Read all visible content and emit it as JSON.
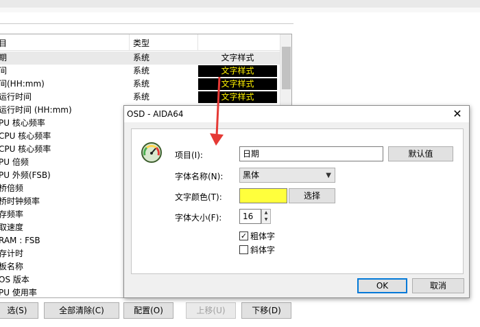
{
  "list": {
    "header": {
      "col1": "目",
      "col2": "类型"
    },
    "rows": [
      {
        "item": "期",
        "type": "系统",
        "style": "文字样式",
        "dark": false,
        "selected": true
      },
      {
        "item": "间",
        "type": "系统",
        "style": "文字样式",
        "dark": true,
        "selected": false
      },
      {
        "item": "间(HH:mm)",
        "type": "系统",
        "style": "文字样式",
        "dark": true,
        "selected": false
      },
      {
        "item": "运行时间",
        "type": "系统",
        "style": "文字样式",
        "dark": true,
        "selected": false
      },
      {
        "item": "运行时间 (HH:mm)",
        "type": "",
        "style": "",
        "dark": false,
        "selected": false
      },
      {
        "item": "PU 核心频率",
        "type": "",
        "style": "",
        "dark": false,
        "selected": false
      },
      {
        "item": " CPU 核心频率",
        "type": "",
        "style": "",
        "dark": false,
        "selected": false
      },
      {
        "item": " CPU 核心频率",
        "type": "",
        "style": "",
        "dark": false,
        "selected": false
      },
      {
        "item": "PU 倍频",
        "type": "",
        "style": "",
        "dark": false,
        "selected": false
      },
      {
        "item": "PU 外频(FSB)",
        "type": "",
        "style": "",
        "dark": false,
        "selected": false
      },
      {
        "item": "桥倍频",
        "type": "",
        "style": "",
        "dark": false,
        "selected": false
      },
      {
        "item": "桥时钟频率",
        "type": "",
        "style": "",
        "dark": false,
        "selected": false
      },
      {
        "item": "存频率",
        "type": "",
        "style": "",
        "dark": false,
        "selected": false
      },
      {
        "item": "取速度",
        "type": "",
        "style": "",
        "dark": false,
        "selected": false
      },
      {
        "item": "RAM : FSB",
        "type": "",
        "style": "",
        "dark": false,
        "selected": false
      },
      {
        "item": "存计时",
        "type": "",
        "style": "",
        "dark": false,
        "selected": false
      },
      {
        "item": "板名称",
        "type": "",
        "style": "",
        "dark": false,
        "selected": false
      },
      {
        "item": "OS 版本",
        "type": "",
        "style": "",
        "dark": false,
        "selected": false
      },
      {
        "item": "PU 使用率",
        "type": "",
        "style": "",
        "dark": false,
        "selected": false
      }
    ]
  },
  "bottom_buttons": {
    "select": "选(S)",
    "clear_all": "全部清除(C)",
    "config": "配置(O)",
    "move_up": "上移(U)",
    "move_down": "下移(D)"
  },
  "dialog": {
    "title": "OSD - AIDA64",
    "close_glyph": "✕",
    "item_label": "项目(I):",
    "item_value": "日期",
    "default_button": "默认值",
    "font_name_label": "字体名称(N):",
    "font_name_value": "黑体",
    "text_color_label": "文字颜色(T):",
    "text_color_value": "#ffff3c",
    "choose_button": "选择",
    "font_size_label": "字体大小(F):",
    "font_size_value": "16",
    "bold_label": "粗体字",
    "bold_checked": true,
    "italic_label": "斜体字",
    "italic_checked": false,
    "ok_button": "OK",
    "cancel_button": "取消"
  },
  "colors": {
    "accent": "#0078d7",
    "annotation_arrow": "#e53935",
    "osd_text": "#fff200"
  },
  "icons": {
    "gauge": "speedometer-icon",
    "arrow": "red-annotation-arrow"
  }
}
